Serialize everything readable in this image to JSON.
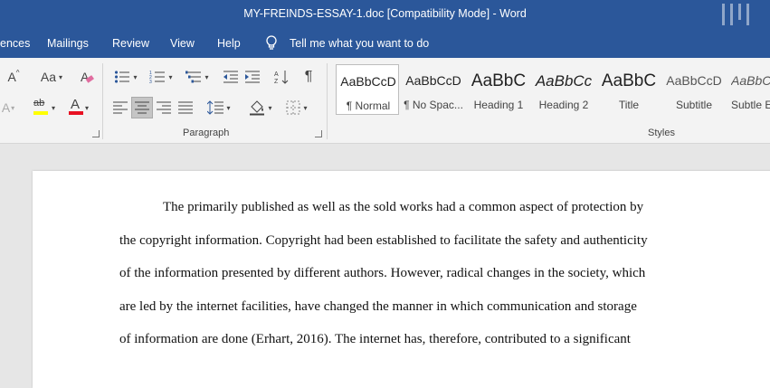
{
  "window": {
    "title": "MY-FREINDS-ESSAY-1.doc [Compatibility Mode]  -  Word"
  },
  "tabs": {
    "references": "ences",
    "mailings": "Mailings",
    "review": "Review",
    "view": "View",
    "help": "Help",
    "tell_me": "Tell me what you want to do"
  },
  "ribbon": {
    "font_size_up": "A",
    "font_size_down": "A",
    "change_case": "Aa",
    "highlight_letters": "ab",
    "font_color_letter": "A",
    "paragraph_label": "Paragraph",
    "styles_label": "Styles",
    "highlight_color": "#ffff00",
    "font_color": "#e81123"
  },
  "styles": [
    {
      "preview": "AaBbCcD",
      "label": "¶ Normal"
    },
    {
      "preview": "AaBbCcD",
      "label": "¶ No Spac..."
    },
    {
      "preview": "AaBbC",
      "label": "Heading 1"
    },
    {
      "preview": "AaBbCc",
      "label": "Heading 2"
    },
    {
      "preview": "AaBbC",
      "label": "Title"
    },
    {
      "preview": "AaBbCcD",
      "label": "Subtitle"
    },
    {
      "preview": "AaBbCc",
      "label": "Subtle E"
    }
  ],
  "document": {
    "lines": [
      "The primarily published as well as the sold works had a common aspect of protection by",
      "the copyright information. Copyright had been established to facilitate the safety and authenticity",
      "of the information presented by different authors. However, radical changes in the society, which",
      "are led by the internet facilities, have changed the manner in which communication and storage",
      "of information are done (Erhart, 2016).  The internet has, therefore, contributed to a significant"
    ]
  },
  "theme": {
    "accent": "#2b579a"
  }
}
